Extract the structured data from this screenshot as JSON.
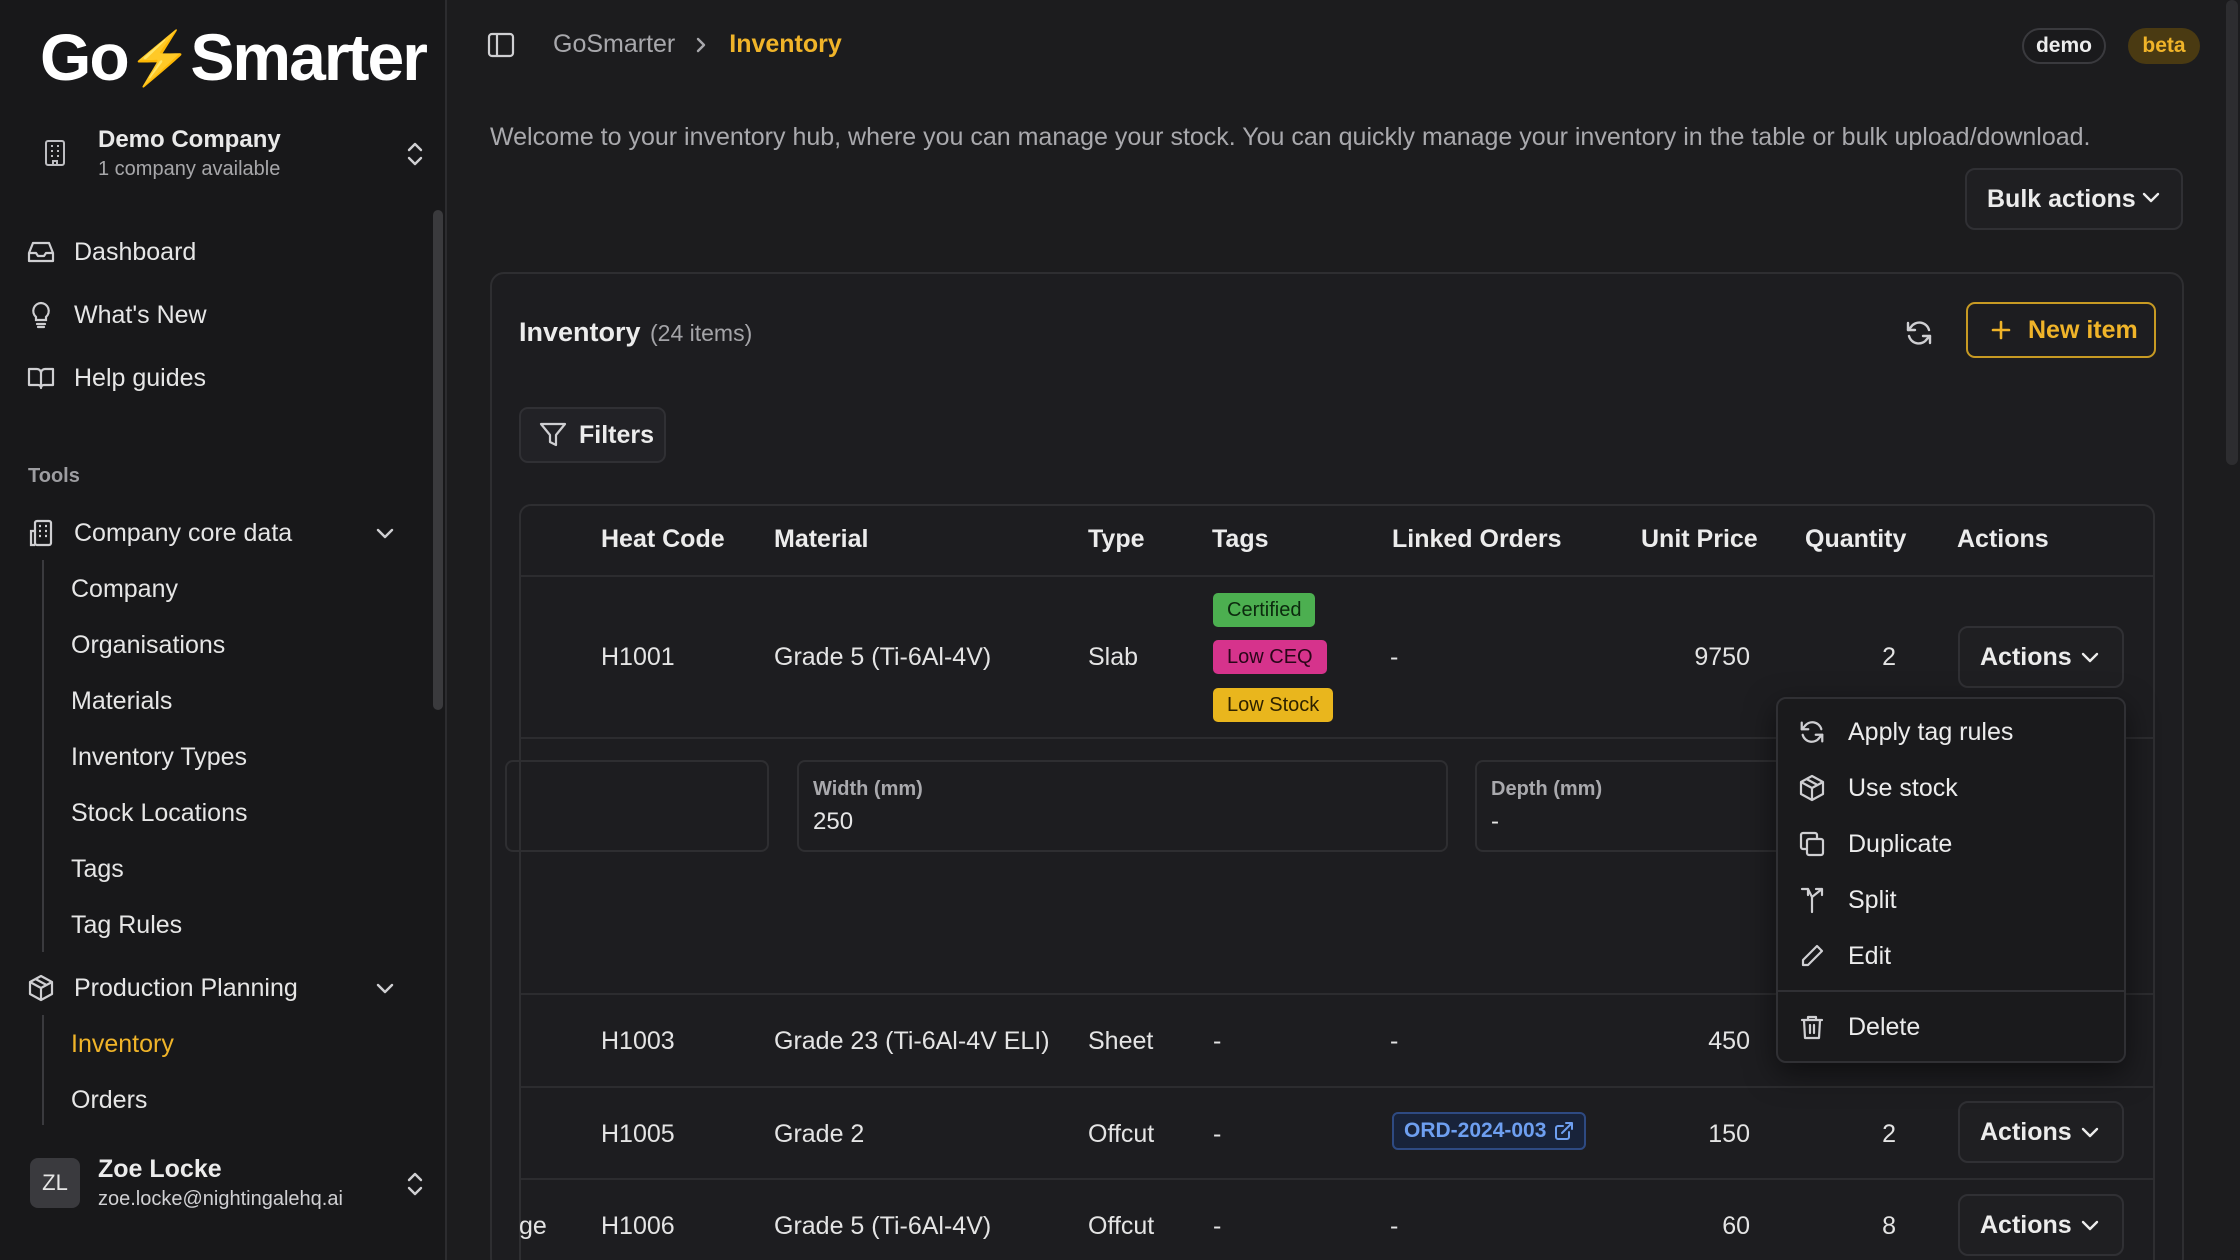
{
  "app": {
    "name": "GoSmarter"
  },
  "company": {
    "name": "Demo Company",
    "subtitle": "1 company available"
  },
  "nav": {
    "dashboard": "Dashboard",
    "whats_new": "What's New",
    "help_guides": "Help guides",
    "tools_label": "Tools",
    "company_core_data": "Company core data",
    "core_items": [
      "Company",
      "Organisations",
      "Materials",
      "Inventory Types",
      "Stock Locations",
      "Tags",
      "Tag Rules"
    ],
    "production_planning": "Production Planning",
    "planning_items": [
      "Inventory",
      "Orders"
    ]
  },
  "user": {
    "initials": "ZL",
    "name": "Zoe Locke",
    "email": "zoe.locke@nightingalehq.ai"
  },
  "breadcrumb": {
    "root": "GoSmarter",
    "current": "Inventory"
  },
  "badges": {
    "demo": "demo",
    "beta": "beta"
  },
  "welcome": "Welcome to your inventory hub, where you can manage your stock. You can quickly manage your inventory in the table or bulk upload/download.",
  "bulk_actions": "Bulk actions",
  "card": {
    "title": "Inventory",
    "count": "(24 items)",
    "new_item": "New item",
    "filters": "Filters"
  },
  "table": {
    "headers": [
      "Heat Code",
      "Material",
      "Type",
      "Tags",
      "Linked Orders",
      "Unit Price",
      "Quantity",
      "Actions"
    ],
    "rows": [
      {
        "heat": "H1001",
        "material": "Grade 5 (Ti-6Al-4V)",
        "type": "Slab",
        "tags": [
          "Certified",
          "Low CEQ",
          "Low Stock"
        ],
        "orders": "-",
        "price": "9750",
        "qty": "2",
        "actions": "Actions"
      },
      {
        "heat": "H1003",
        "material": "Grade 23 (Ti-6Al-4V ELI)",
        "type": "Sheet",
        "tags": "-",
        "orders": "-",
        "price": "450",
        "qty": "",
        "actions": ""
      },
      {
        "heat": "H1005",
        "material": "Grade 2",
        "type": "Offcut",
        "tags": "-",
        "orders": "ORD-2024-003",
        "price": "150",
        "qty": "2",
        "actions": "Actions"
      },
      {
        "prefix": "ge",
        "heat": "H1006",
        "material": "Grade 5 (Ti-6Al-4V)",
        "type": "Offcut",
        "tags": "-",
        "orders": "-",
        "price": "60",
        "qty": "8",
        "actions": "Actions"
      }
    ],
    "expanded": {
      "width_label": "Width (mm)",
      "width_value": "250",
      "depth_label": "Depth (mm)",
      "depth_value": "-"
    }
  },
  "tag_colors": {
    "Certified": "#4caf50",
    "Low CEQ": "#d6338c",
    "Low Stock": "#e9b61d"
  },
  "dropdown": [
    "Apply tag rules",
    "Use stock",
    "Duplicate",
    "Split",
    "Edit",
    "Delete"
  ],
  "colors": {
    "accent": "#f0b429",
    "link": "#6e9ff0"
  }
}
